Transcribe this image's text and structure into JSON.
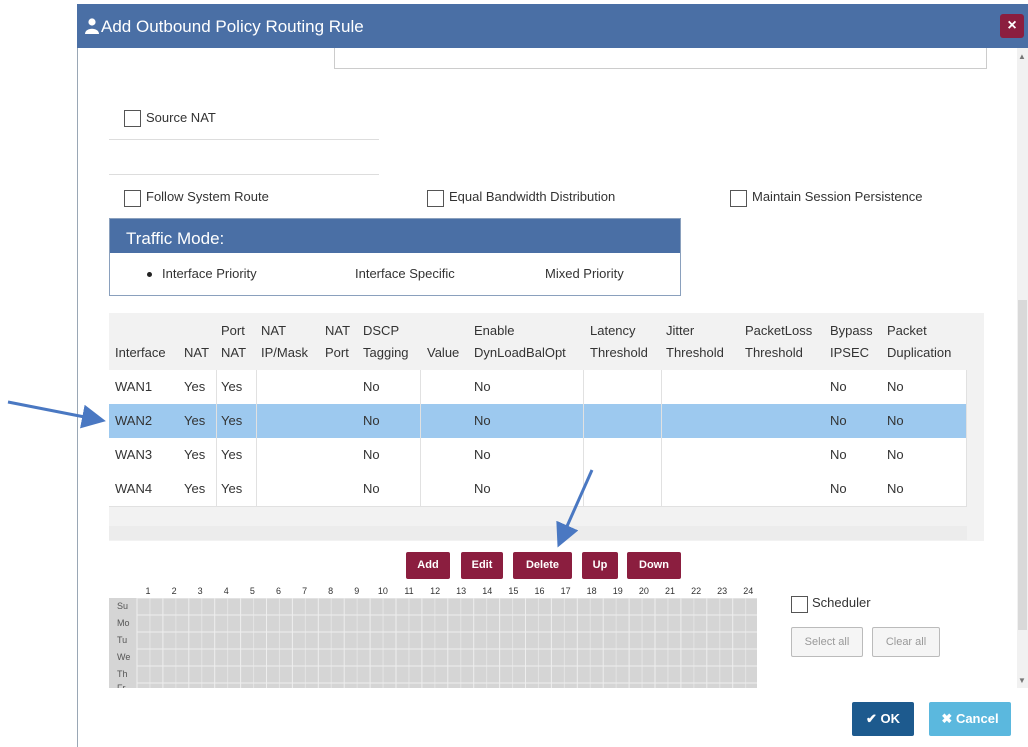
{
  "dialog": {
    "title": "Add Outbound Policy Routing Rule",
    "close_label": "×",
    "user_icon": "user-icon",
    "colors": {
      "titlebar": "#4a6fa5",
      "close": "#8b1e3f",
      "selected_row": "#9dc9ef",
      "action_button": "#8b1e3f",
      "ok": "#1d5a8e",
      "cancel": "#5bb8de"
    }
  },
  "options": {
    "source_nat": "Source NAT",
    "follow_system_route": "Follow System Route",
    "equal_bandwidth": "Equal Bandwidth Distribution",
    "maintain_session": "Maintain Session Persistence"
  },
  "traffic_mode": {
    "title": "Traffic Mode:",
    "options": [
      "Interface Priority",
      "Interface Specific",
      "Mixed Priority"
    ],
    "selected": "Interface Priority"
  },
  "table": {
    "headers": [
      {
        "line1": "",
        "line2": "Interface"
      },
      {
        "line1": "",
        "line2": "NAT"
      },
      {
        "line1": "Port",
        "line2": "NAT"
      },
      {
        "line1": "NAT",
        "line2": "IP/Mask"
      },
      {
        "line1": "NAT",
        "line2": "Port"
      },
      {
        "line1": "DSCP",
        "line2": "Tagging"
      },
      {
        "line1": "",
        "line2": "Value"
      },
      {
        "line1": "Enable",
        "line2": "DynLoadBalOpt"
      },
      {
        "line1": "Latency",
        "line2": "Threshold"
      },
      {
        "line1": "Jitter",
        "line2": "Threshold"
      },
      {
        "line1": "PacketLoss",
        "line2": "Threshold"
      },
      {
        "line1": "Bypass",
        "line2": "IPSEC"
      },
      {
        "line1": "Packet",
        "line2": "Duplication"
      }
    ],
    "rows": [
      {
        "interface": "WAN1",
        "nat": "Yes",
        "port_nat": "Yes",
        "dscp": "No",
        "dynlb": "No",
        "bypass": "No",
        "dup": "No"
      },
      {
        "interface": "WAN2",
        "nat": "Yes",
        "port_nat": "Yes",
        "dscp": "No",
        "dynlb": "No",
        "bypass": "No",
        "dup": "No"
      },
      {
        "interface": "WAN3",
        "nat": "Yes",
        "port_nat": "Yes",
        "dscp": "No",
        "dynlb": "No",
        "bypass": "No",
        "dup": "No"
      },
      {
        "interface": "WAN4",
        "nat": "Yes",
        "port_nat": "Yes",
        "dscp": "No",
        "dynlb": "No",
        "bypass": "No",
        "dup": "No"
      }
    ],
    "selected_row": "WAN2"
  },
  "actions": {
    "add": "Add",
    "edit": "Edit",
    "delete": "Delete",
    "up": "Up",
    "down": "Down"
  },
  "scheduler": {
    "hours": [
      "1",
      "2",
      "3",
      "4",
      "5",
      "6",
      "7",
      "8",
      "9",
      "10",
      "11",
      "12",
      "13",
      "14",
      "15",
      "16",
      "17",
      "18",
      "19",
      "20",
      "21",
      "22",
      "23",
      "24"
    ],
    "days": [
      "Su",
      "Mo",
      "Tu",
      "We",
      "Th",
      "Fr"
    ],
    "label": "Scheduler",
    "select_all": "Select all",
    "clear_all": "Clear all"
  },
  "footer": {
    "ok": "OK",
    "cancel": "Cancel",
    "ok_icon": "check-icon",
    "cancel_icon": "x-icon"
  }
}
